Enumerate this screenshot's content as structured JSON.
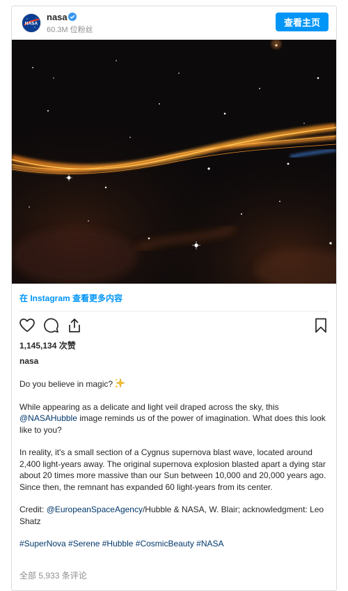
{
  "header": {
    "username": "nasa",
    "followers": "60.3M 位粉丝",
    "view_profile_label": "查看主页",
    "avatar_text": "NASA"
  },
  "post": {
    "more_on_instagram": "在 Instagram 查看更多内容",
    "likes": "1,145,134 次赞",
    "author": "nasa",
    "caption": {
      "line1": "Do you believe in magic?",
      "p2_before": "While appearing as a delicate and light veil draped across the sky, this ",
      "p2_mention": "@NASAHubble",
      "p2_after": " image reminds us of the power of imagination. What does this look like to you?",
      "p3": "In reality, it's a small section of a Cygnus supernova blast wave, located around 2,400 light-years away. The original supernova explosion blasted apart a dying star about 20 times more massive than our Sun between 10,000 and 20,000 years ago. Since then, the remnant has expanded 60 light-years from its center.",
      "p4_prefix": "Credit: ",
      "p4_mention": "@EuropeanSpaceAgency",
      "p4_after": "/Hubble & NASA, W. Blair; acknowledgment: Leo Shatz",
      "hashtags": "#SuperNova #Serene #Hubble #CosmicBeauty #NASA"
    },
    "comments": "全部 5,933 条评论"
  },
  "icons": {
    "like": "heart-icon",
    "comment": "comment-icon",
    "share": "share-icon",
    "save": "bookmark-icon",
    "verified": "verified-badge-icon",
    "sparkle": "sparkles-emoji-icon"
  },
  "colors": {
    "accent": "#0095f6",
    "link": "#00376b",
    "muted": "#8e8e8e",
    "text": "#262626"
  }
}
